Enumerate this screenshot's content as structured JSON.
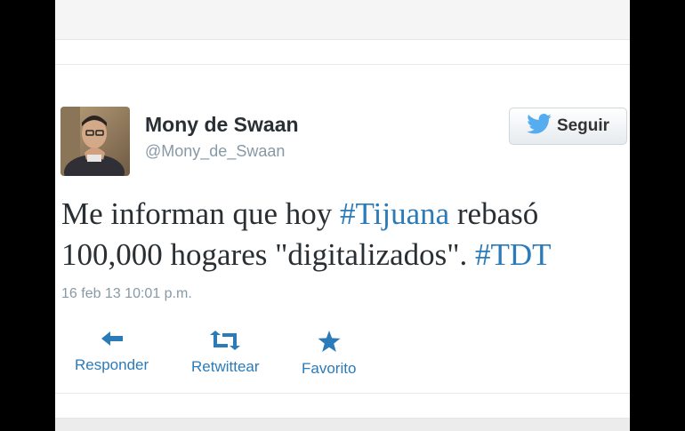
{
  "user": {
    "name": "Mony de Swaan",
    "handle": "@Mony_de_Swaan"
  },
  "follow_button": {
    "label": "Seguir"
  },
  "tweet": {
    "text_parts": [
      "Me informan que hoy ",
      "#Tijuana",
      " rebasó",
      "100,000 hogares \"digitalizados\". ",
      "#TDT"
    ],
    "timestamp": "16 feb 13 10:01 p.m."
  },
  "actions": {
    "reply": "Responder",
    "retweet": "Retwittear",
    "favorite": "Favorito"
  },
  "colors": {
    "link": "#2b7bb9",
    "twitter_bird": "#55acee",
    "text": "#292f33",
    "muted": "#8899a6"
  },
  "icons": {
    "follow": "twitter-bird-icon",
    "reply": "reply-arrow-icon",
    "retweet": "retweet-icon",
    "favorite": "star-icon"
  }
}
